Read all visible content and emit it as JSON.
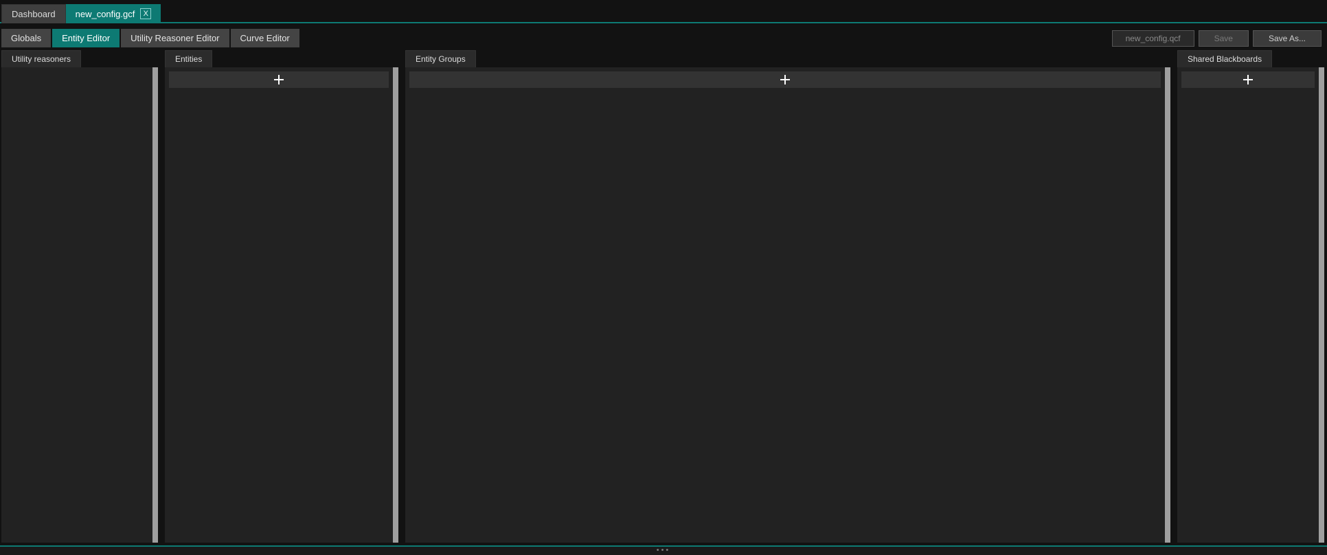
{
  "docTabs": {
    "dashboard": "Dashboard",
    "activeFile": "new_config.gcf",
    "closeLabel": "X"
  },
  "modeTabs": {
    "globals": "Globals",
    "entityEditor": "Entity Editor",
    "utilityReasonerEditor": "Utility Reasoner Editor",
    "curveEditor": "Curve Editor"
  },
  "saveBar": {
    "filename": "new_config.qcf",
    "save": "Save",
    "saveAs": "Save As..."
  },
  "panels": {
    "utilityReasoners": "Utility reasoners",
    "entities": "Entities",
    "entityGroups": "Entity Groups",
    "sharedBlackboards": "Shared Blackboards"
  }
}
